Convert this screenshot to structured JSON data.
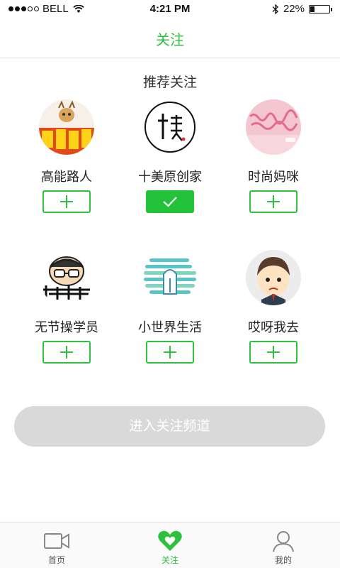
{
  "status": {
    "carrier": "BELL",
    "time": "4:21 PM",
    "battery": "22%",
    "battery_fraction": 0.22,
    "signal_bars": 3
  },
  "header": {
    "title": "关注"
  },
  "section": {
    "title": "推荐关注"
  },
  "accounts": [
    {
      "name": "高能路人",
      "followed": false
    },
    {
      "name": "十美原创家",
      "followed": true
    },
    {
      "name": "时尚妈咪",
      "followed": false
    },
    {
      "name": "无节操学员",
      "followed": false
    },
    {
      "name": "小世界生活",
      "followed": false
    },
    {
      "name": "哎呀我去",
      "followed": false
    }
  ],
  "enter_button": {
    "label": "进入关注频道"
  },
  "tabs": [
    {
      "label": "首页",
      "icon": "video-camera-icon"
    },
    {
      "label": "关注",
      "icon": "heart-icon"
    },
    {
      "label": "我的",
      "icon": "person-icon"
    }
  ],
  "colors": {
    "accent": "#2ec13e",
    "disabled_button": "#d9d9d9"
  }
}
